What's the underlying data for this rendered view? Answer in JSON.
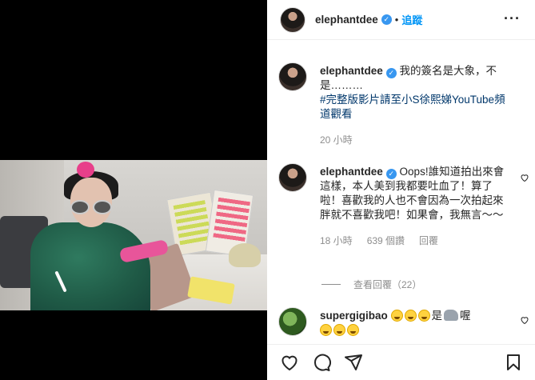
{
  "post": {
    "username": "elephantdee",
    "follow_label": "追蹤",
    "dot": "•"
  },
  "caption": {
    "username": "elephantdee",
    "text": "我的簽名是大象，不是………",
    "hashtag": "#完整版影片請至小S徐熙娣YouTube頻道觀看",
    "time": "20 小時"
  },
  "comments": [
    {
      "username": "elephantdee",
      "text": "Oops!誰知道拍出來會這樣，本人美到我都要吐血了！算了啦！喜歡我的人也不會因為一次拍起來胖就不喜歡我吧！如果會，我無言～～",
      "time": "18 小時",
      "likes": "639 個讚",
      "reply": "回覆",
      "view_replies": "查看回覆（22）"
    },
    {
      "username": "supergigibao",
      "text_mid": "是",
      "text_end": "喔"
    }
  ],
  "icons": {
    "heart": "heart-icon",
    "comment": "comment-icon",
    "share": "share-icon",
    "save": "bookmark-icon",
    "more": "more-icon"
  },
  "colors": {
    "accent": "#0095f6",
    "verified": "#3897f0",
    "hashtag": "#00376b",
    "muted": "#8e8e8e"
  }
}
